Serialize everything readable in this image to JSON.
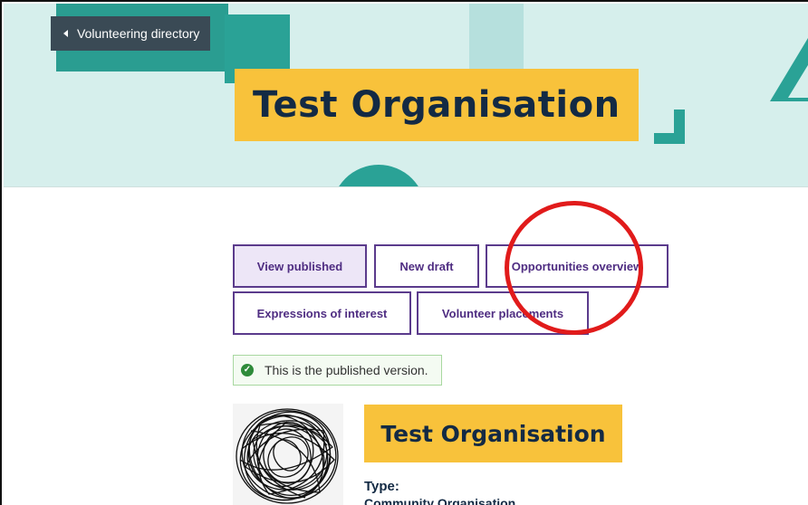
{
  "nav": {
    "back_label": "Volunteering directory"
  },
  "hero": {
    "title": "Test Organisation"
  },
  "tabs": [
    {
      "label": "View published",
      "active": true
    },
    {
      "label": "New draft",
      "active": false
    },
    {
      "label": "Opportunities overview",
      "active": false
    },
    {
      "label": "Expressions of interest",
      "active": false
    },
    {
      "label": "Volunteer placements",
      "active": false
    }
  ],
  "notice": {
    "text": "This is the published version."
  },
  "organisation": {
    "name": "Test Organisation",
    "type_label": "Type:",
    "type_value": "Community Organisation"
  },
  "colors": {
    "hero_bg": "#d6efec",
    "accent_teal": "#2aa296",
    "title_yellow": "#f8c23b",
    "tab_purple": "#5b3b8c",
    "annotation_red": "#e11b1b"
  }
}
